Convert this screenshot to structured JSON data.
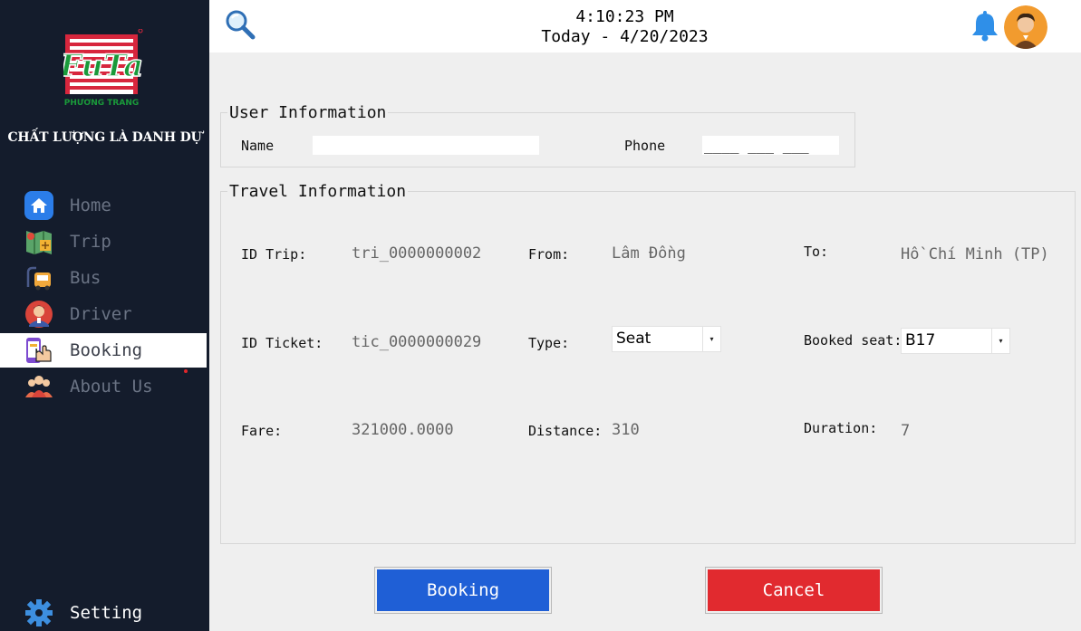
{
  "brand": {
    "logo_text": "FuTa",
    "logo_subtext": "PHƯƠNG TRANG",
    "slogan": "CHẤT LƯỢNG LÀ DANH DỰ"
  },
  "sidebar": {
    "items": [
      {
        "label": "Home",
        "icon": "home-icon"
      },
      {
        "label": "Trip",
        "icon": "map-icon"
      },
      {
        "label": "Bus",
        "icon": "bus-icon"
      },
      {
        "label": "Driver",
        "icon": "driver-icon"
      },
      {
        "label": "Booking",
        "icon": "booking-icon",
        "active": true
      },
      {
        "label": "About Us",
        "icon": "people-icon"
      }
    ],
    "setting_label": "Setting"
  },
  "header": {
    "time": "4:10:23 PM",
    "date": "Today - 4/20/2023"
  },
  "user_info": {
    "title": "User Information",
    "name_label": "Name",
    "name_value": "",
    "phone_label": "Phone",
    "phone_value": "____ ___ ___"
  },
  "travel_info": {
    "title": "Travel Information",
    "id_trip_label": "ID Trip:",
    "id_trip_value": "tri_0000000002",
    "from_label": "From:",
    "from_value": "Lâm Đồng",
    "to_label": "To:",
    "to_value": "Hồ Chí Minh (TP)",
    "id_ticket_label": "ID Ticket:",
    "id_ticket_value": "tic_0000000029",
    "type_label": "Type:",
    "type_value": "Seat",
    "booked_seat_label": "Booked seat:",
    "booked_seat_value": "B17",
    "fare_label": "Fare:",
    "fare_value": "321000.0000",
    "distance_label": "Distance:",
    "distance_value": "310",
    "duration_label": "Duration:",
    "duration_value": "7"
  },
  "actions": {
    "booking_label": "Booking",
    "cancel_label": "Cancel"
  },
  "colors": {
    "sidebar_bg": "#141c2c",
    "booking_button": "#1f5fd6",
    "cancel_button": "#e12a2f",
    "logo_red": "#d7263d",
    "logo_green": "#1a9a3a"
  }
}
